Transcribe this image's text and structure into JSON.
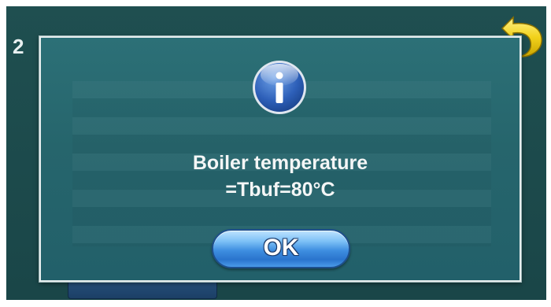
{
  "screen": {
    "corner_digit": "2"
  },
  "dialog": {
    "icon": "info-icon",
    "message_line1": "Boiler temperature",
    "message_line2": "=Tbuf=80°C",
    "ok_label": "OK"
  },
  "back_button": {
    "icon": "back-arrow-icon"
  },
  "colors": {
    "background": "#1f4f50",
    "dialog": "#2a6b72",
    "ok_button": "#3e8ee0",
    "back_arrow": "#f2d21b"
  }
}
